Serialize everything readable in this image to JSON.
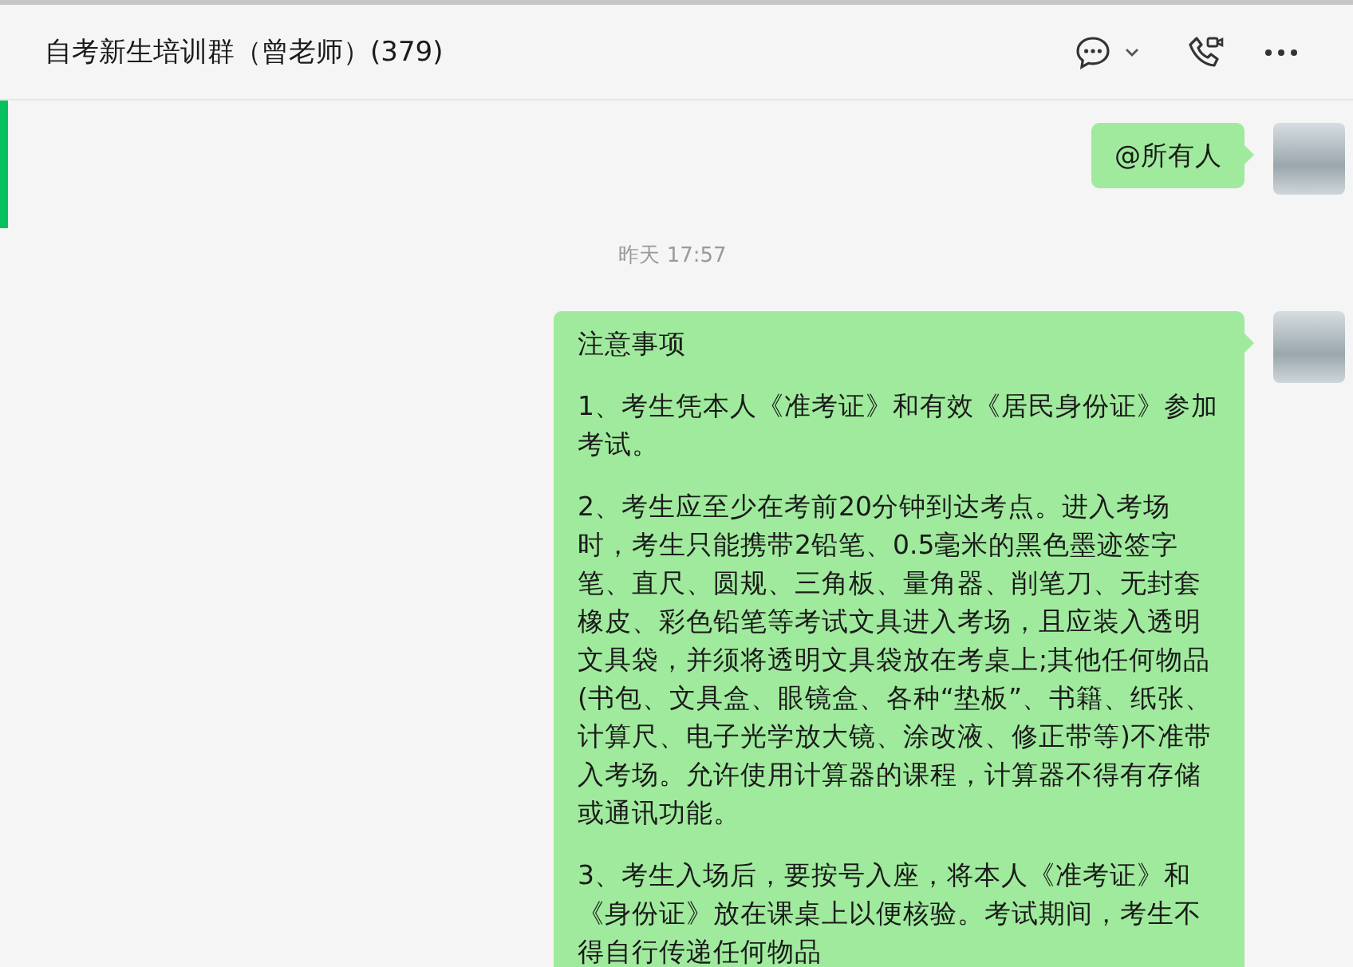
{
  "chat": {
    "title": "自考新生培训群（曾老师）(379)"
  },
  "messages": [
    {
      "kind": "bubble",
      "paragraphs": [
        "@所有人"
      ]
    },
    {
      "kind": "time",
      "text": "昨天 17:57"
    },
    {
      "kind": "bubble",
      "paragraphs": [
        "注意事项",
        "1、考生凭本人《准考证》和有效《居民身份证》参加考试。",
        "2、考生应至少在考前20分钟到达考点。进入考场时，考生只能携带2铅笔、0.5毫米的黑色墨迹签字笔、直尺、圆规、三角板、量角器、削笔刀、无封套橡皮、彩色铅笔等考试文具进入考场，且应装入透明文具袋，并须将透明文具袋放在考桌上;其他任何物品(书包、文具盒、眼镜盒、各种“垫板”、书籍、纸张、计算尺、电子光学放大镜、涂改液、修正带等)不准带入考场。允许使用计算器的课程，计算器不得有存储或通讯功能。",
        "3、考生入场后，要按号入座，将本人《准考证》和《身份证》放在课桌上以便核验。考试期间，考生不得自行传递任何物品"
      ]
    }
  ]
}
